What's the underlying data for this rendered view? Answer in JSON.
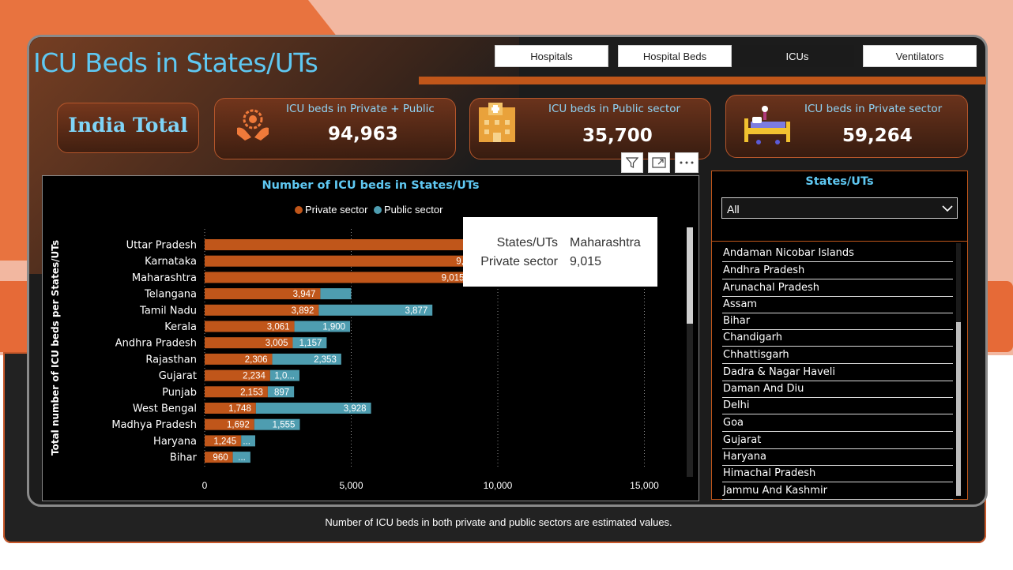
{
  "page": {
    "title": "ICU Beds in States/UTs",
    "footnote": "Number of ICU beds in both private and public sectors are estimated values."
  },
  "nav": {
    "tabs": [
      {
        "label": "Hospitals",
        "active": false
      },
      {
        "label": "Hospital Beds",
        "active": false
      },
      {
        "label": "ICUs",
        "active": true
      },
      {
        "label": "Ventilators",
        "active": false
      }
    ]
  },
  "summary": {
    "india_label": "India Total",
    "cards": [
      {
        "label": "ICU beds in Private + Public",
        "value": "94,963",
        "icon": "care-hands-icon"
      },
      {
        "label": "ICU beds in Public sector",
        "value": "35,700",
        "icon": "hospital-building-icon"
      },
      {
        "label": "ICU beds in Private sector",
        "value": "59,264",
        "icon": "hospital-bed-icon"
      }
    ]
  },
  "visual_header": {
    "icons": [
      "filter-icon",
      "focus-mode-icon",
      "more-options-icon"
    ]
  },
  "tooltip": {
    "rows": [
      {
        "key": "States/UTs",
        "value": "Maharashtra"
      },
      {
        "key": "Private sector",
        "value": "9,015"
      }
    ]
  },
  "slicer": {
    "title": "States/UTs",
    "selected": "All",
    "items": [
      "Andaman Nicobar Islands",
      "Andhra Pradesh",
      "Arunachal Pradesh",
      "Assam",
      "Bihar",
      "Chandigarh",
      "Chhattisgarh",
      "Dadra & Nagar Haveli",
      "Daman And Diu",
      "Delhi",
      "Goa",
      "Gujarat",
      "Haryana",
      "Himachal Pradesh",
      "Jammu And Kashmir"
    ]
  },
  "colors": {
    "private": "#c0561a",
    "public": "#4e9db0",
    "accent_blue": "#5fc8f2"
  },
  "chart_data": {
    "type": "bar",
    "orientation": "horizontal",
    "stacked": true,
    "title": "Number of ICU beds in States/UTs",
    "ylabel": "Total number of ICU beds per States/UTs",
    "xlabel": "",
    "xlim": [
      0,
      16000
    ],
    "xticks": [
      "0",
      "5,000",
      "10,000",
      "15,000"
    ],
    "xtick_values": [
      0,
      5000,
      10000,
      15000
    ],
    "grid": "vertical-dotted",
    "legend": "top-center",
    "categories": [
      "Uttar Pradesh",
      "Karnataka",
      "Maharashtra",
      "Telangana",
      "Tamil Nadu",
      "Kerala",
      "Andhra Pradesh",
      "Rajasthan",
      "Gujarat",
      "Punjab",
      "West Bengal",
      "Madhya Pradesh",
      "Haryana",
      "Bihar"
    ],
    "series": [
      {
        "name": "Private sector",
        "values": [
          9000,
          9000,
          9015,
          3947,
          3892,
          3061,
          3005,
          2306,
          2234,
          2153,
          1748,
          1692,
          1245,
          960
        ],
        "labels": [
          "",
          "9,",
          "9,015",
          "3,947",
          "3,892",
          "3,061",
          "3,005",
          "2,306",
          "2,234",
          "2,153",
          "1,748",
          "1,692",
          "1,245",
          "960"
        ]
      },
      {
        "name": "Public sector",
        "values": [
          0,
          0,
          0,
          1050,
          3877,
          1900,
          1157,
          2353,
          1000,
          897,
          3928,
          1555,
          480,
          600
        ],
        "labels": [
          "",
          "",
          "",
          "",
          "3,877",
          "1,900",
          "1,157",
          "2,353",
          "1,0...",
          "897",
          "3,928",
          "1,555",
          "...",
          "..."
        ]
      }
    ]
  }
}
